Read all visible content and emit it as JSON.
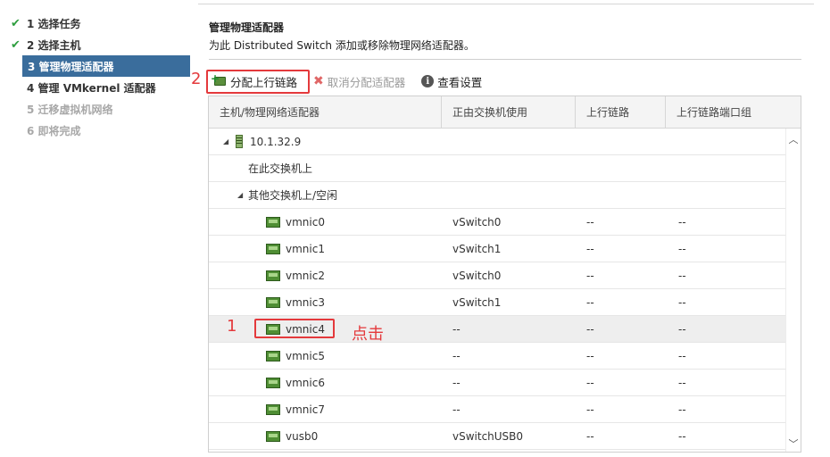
{
  "nav": {
    "items": [
      {
        "label": "1 选择任务",
        "state": "done"
      },
      {
        "label": "2 选择主机",
        "state": "done"
      },
      {
        "label": "3 管理物理适配器",
        "state": "active"
      },
      {
        "label": "4 管理 VMkernel 适配器",
        "state": "normal"
      },
      {
        "label": "5 迁移虚拟机网络",
        "state": "disabled"
      },
      {
        "label": "6 即将完成",
        "state": "disabled"
      }
    ]
  },
  "header": {
    "title": "管理物理适配器",
    "description": "为此 Distributed Switch 添加或移除物理网络适配器。"
  },
  "toolbar": {
    "assign_uplink": "分配上行链路",
    "unassign": "取消分配适配器",
    "view_settings": "查看设置"
  },
  "table": {
    "columns": [
      "主机/物理网络适配器",
      "正由交换机使用",
      "上行链路",
      "上行链路端口组"
    ],
    "host": "10.1.32.9",
    "group_this": "在此交换机上",
    "group_other": "其他交换机上/空闲",
    "rows": [
      {
        "name": "vmnic0",
        "switch": "vSwitch0",
        "uplink": "--",
        "portgroup": "--"
      },
      {
        "name": "vmnic1",
        "switch": "vSwitch1",
        "uplink": "--",
        "portgroup": "--"
      },
      {
        "name": "vmnic2",
        "switch": "vSwitch0",
        "uplink": "--",
        "portgroup": "--"
      },
      {
        "name": "vmnic3",
        "switch": "vSwitch1",
        "uplink": "--",
        "portgroup": "--"
      },
      {
        "name": "vmnic4",
        "switch": "--",
        "uplink": "--",
        "portgroup": "--"
      },
      {
        "name": "vmnic5",
        "switch": "--",
        "uplink": "--",
        "portgroup": "--"
      },
      {
        "name": "vmnic6",
        "switch": "--",
        "uplink": "--",
        "portgroup": "--"
      },
      {
        "name": "vmnic7",
        "switch": "--",
        "uplink": "--",
        "portgroup": "--"
      },
      {
        "name": "vusb0",
        "switch": "vSwitchUSB0",
        "uplink": "--",
        "portgroup": "--"
      }
    ]
  },
  "annotations": {
    "step1": "1",
    "step2": "2",
    "click_text": "点击"
  },
  "colors": {
    "active_nav": "#3a6d9c",
    "annotation": "#e4393c",
    "check": "#2e9e3f"
  }
}
